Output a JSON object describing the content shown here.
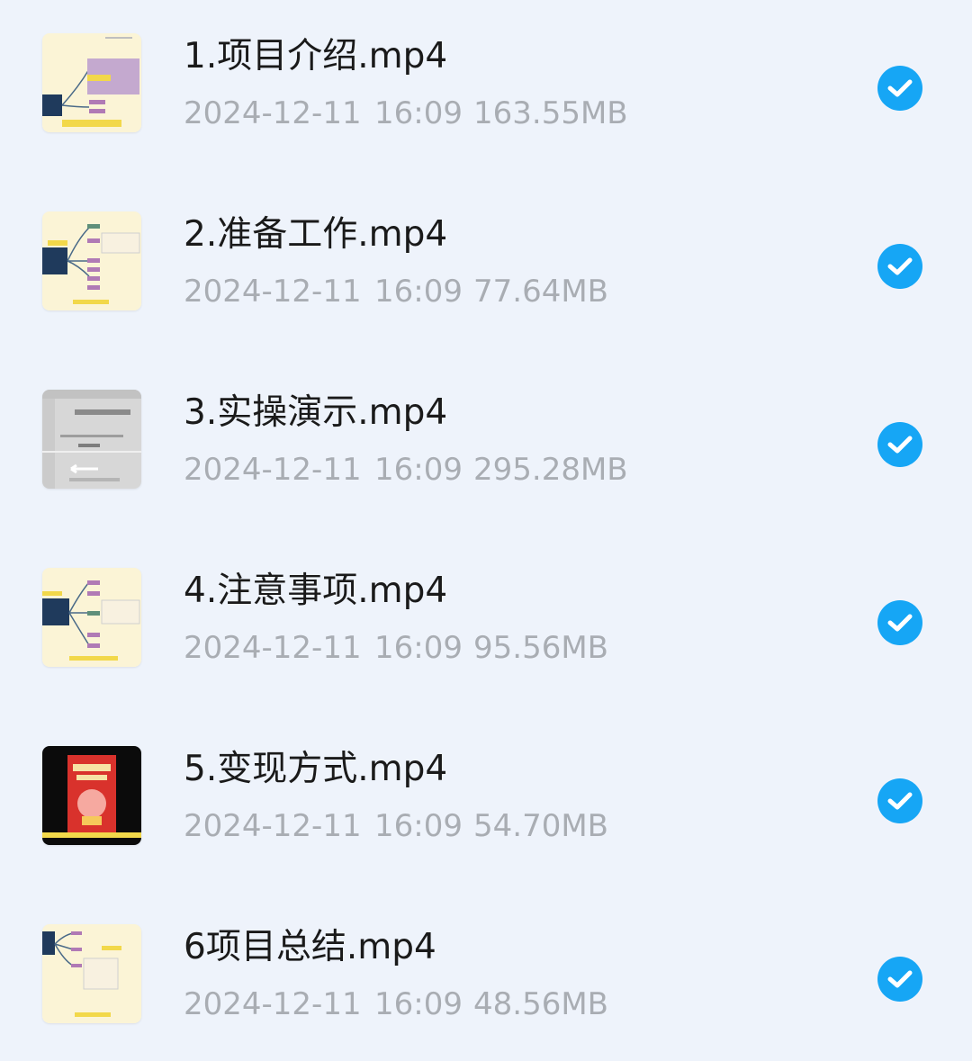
{
  "files": [
    {
      "name": "1.项目介绍.mp4",
      "date": "2024-12-11",
      "time": "16:09",
      "size": "163.55MB",
      "thumbnail": "mindmap-thumbnail",
      "selected": true
    },
    {
      "name": "2.准备工作.mp4",
      "date": "2024-12-11",
      "time": "16:09",
      "size": "77.64MB",
      "thumbnail": "mindmap-thumbnail",
      "selected": true
    },
    {
      "name": "3.实操演示.mp4",
      "date": "2024-12-11",
      "time": "16:09",
      "size": "295.28MB",
      "thumbnail": "screen-recording-thumbnail",
      "selected": true
    },
    {
      "name": "4.注意事项.mp4",
      "date": "2024-12-11",
      "time": "16:09",
      "size": "95.56MB",
      "thumbnail": "mindmap-thumbnail",
      "selected": true
    },
    {
      "name": "5.变现方式.mp4",
      "date": "2024-12-11",
      "time": "16:09",
      "size": "54.70MB",
      "thumbnail": "red-poster-thumbnail",
      "selected": true
    },
    {
      "name": "6项目总结.mp4",
      "date": "2024-12-11",
      "time": "16:09",
      "size": "48.56MB",
      "thumbnail": "mindmap-thumbnail",
      "selected": true
    }
  ],
  "icons": {
    "selected": "check-circle-icon"
  },
  "colors": {
    "background": "#eef3fb",
    "accent": "#16a6f5",
    "name_text": "#1a1a1a",
    "meta_text": "#a9adb3"
  }
}
